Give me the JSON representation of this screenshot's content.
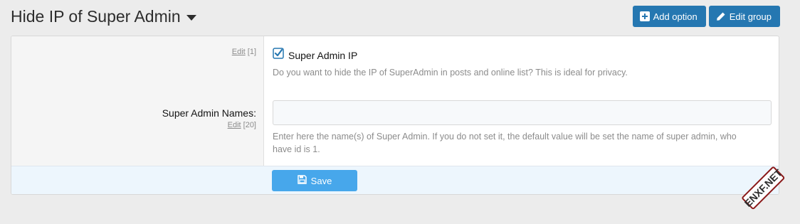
{
  "header": {
    "title": "Hide IP of Super Admin",
    "buttons": {
      "add_option": "Add option",
      "edit_group": "Edit group"
    }
  },
  "options": {
    "super_admin_ip": {
      "edit_label": "Edit",
      "order": "[1]",
      "checkbox_label": "Super Admin IP",
      "checked": true,
      "hint": "Do you want to hide the IP of SuperAdmin in posts and online list? This is ideal for privacy."
    },
    "super_admin_names": {
      "label": "Super Admin Names:",
      "edit_label": "Edit",
      "order": "[20]",
      "value": "",
      "hint_line1": "Enter here the name(s) of Super Admin. If you do not set it, the default value will be set the name of super admin, who",
      "hint_line2": "have id is 1."
    }
  },
  "footer": {
    "save_label": "Save"
  },
  "watermark": {
    "text": "ENXF.NET"
  },
  "colors": {
    "primary_button": "#2577b1",
    "save_button": "#47a7eb",
    "checkbox_accent": "#2577b1",
    "footer_bg": "#edf6fd"
  }
}
